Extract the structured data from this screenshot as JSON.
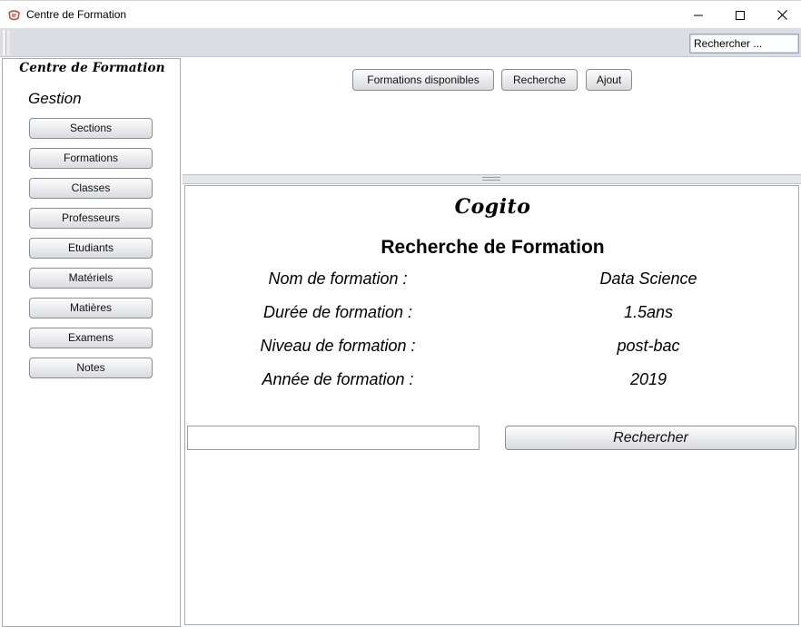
{
  "window": {
    "title": "Centre de Formation",
    "controls": [
      "minimize",
      "maximize",
      "close"
    ]
  },
  "toolbar": {
    "search_value": "Rechercher ..."
  },
  "sidebar": {
    "brand": "Centre de Formation",
    "heading": "Gestion",
    "items": [
      {
        "label": "Sections"
      },
      {
        "label": "Formations"
      },
      {
        "label": "Classes"
      },
      {
        "label": "Professeurs"
      },
      {
        "label": "Etudiants"
      },
      {
        "label": "Matériels"
      },
      {
        "label": "Matières"
      },
      {
        "label": "Examens"
      },
      {
        "label": "Notes"
      }
    ]
  },
  "top_nav": {
    "buttons": [
      {
        "label": "Formations disponibles"
      },
      {
        "label": "Recherche"
      },
      {
        "label": "Ajout"
      }
    ]
  },
  "main": {
    "brand": "Cogito",
    "title": "Recherche de Formation",
    "fields": [
      {
        "label": "Nom de formation :",
        "value": "Data Science"
      },
      {
        "label": "Durée de formation :",
        "value": "1.5ans"
      },
      {
        "label": "Niveau de formation :",
        "value": "post-bac"
      },
      {
        "label": "Année de formation :",
        "value": "2019"
      }
    ],
    "search_input_value": "",
    "search_button_label": "Rechercher"
  },
  "colors": {
    "toolbar_bg": "#dcdde3",
    "panel_border": "#a9abb3",
    "button_border": "#8a8d94"
  }
}
